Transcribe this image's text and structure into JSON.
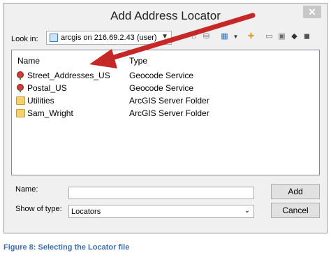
{
  "dialog": {
    "title": "Add Address Locator",
    "close_label": "✕"
  },
  "lookin": {
    "label": "Look in:",
    "value": "arcgis on 216.69.2.43 (user)"
  },
  "filelist": {
    "columns": [
      "Name",
      "Type"
    ],
    "rows": [
      {
        "name": "Street_Addresses_US",
        "type": "Geocode Service",
        "icon": "locator-icon"
      },
      {
        "name": "Postal_US",
        "type": "Geocode Service",
        "icon": "locator-icon"
      },
      {
        "name": "Utilities",
        "type": "ArcGIS Server Folder",
        "icon": "folder-icon"
      },
      {
        "name": "Sam_Wright",
        "type": "ArcGIS Server Folder",
        "icon": "folder-icon"
      }
    ]
  },
  "form": {
    "name_label": "Name:",
    "name_value": "",
    "type_label": "Show of type:",
    "type_value": "Locators"
  },
  "buttons": {
    "add": "Add",
    "cancel": "Cancel"
  },
  "caption": "Figure 8: Selecting the Locator file",
  "colors": {
    "arrow": "#c62828",
    "caption": "#3d6fb6"
  }
}
